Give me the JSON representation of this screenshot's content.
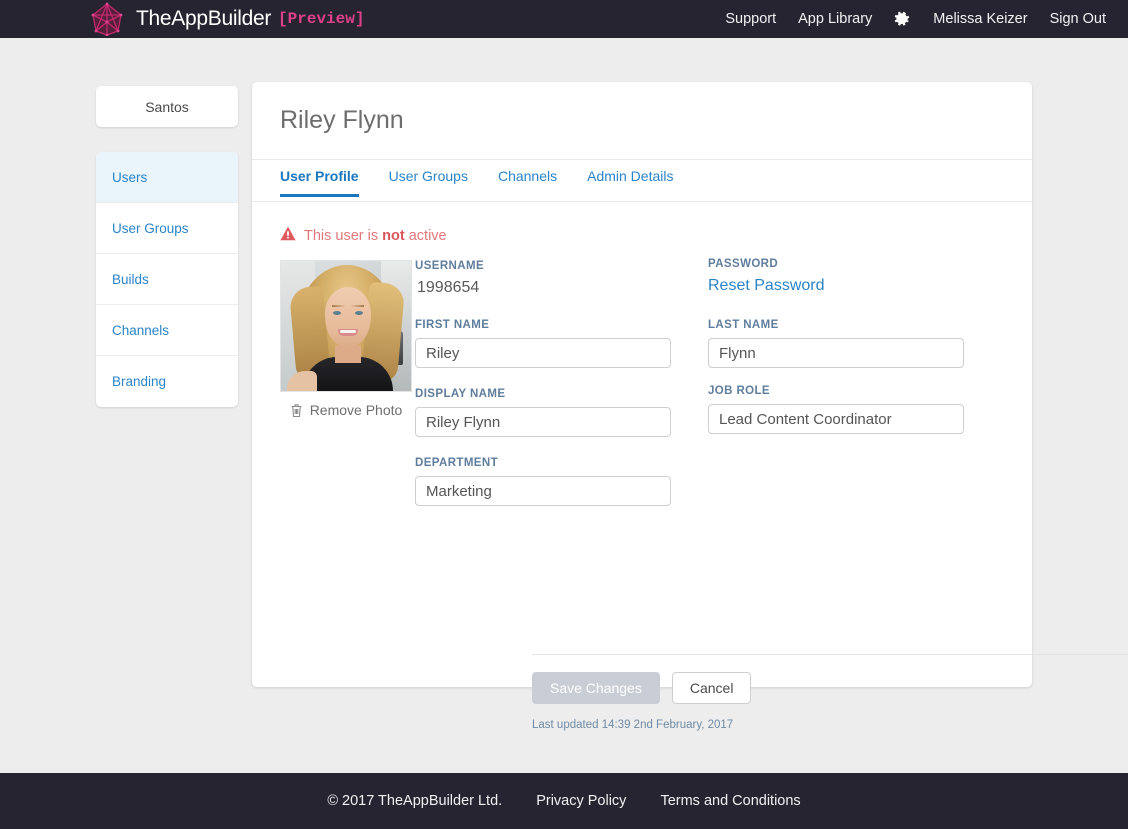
{
  "header": {
    "brand_name": "TheAppBuilder",
    "brand_tag": "[Preview]",
    "logo_icon": "crystal-polygon-logo",
    "nav": [
      {
        "label": "Support"
      },
      {
        "label": "App Library"
      }
    ],
    "settings_icon": "gear-icon",
    "user_name": "Melissa Keizer",
    "sign_out": "Sign Out",
    "background_color": "#262430",
    "accent_color": "#e0408a"
  },
  "sidebar": {
    "org_button": "Santos",
    "items": [
      {
        "label": "Users",
        "active": true
      },
      {
        "label": "User Groups",
        "active": false
      },
      {
        "label": "Builds",
        "active": false
      },
      {
        "label": "Channels",
        "active": false
      },
      {
        "label": "Branding",
        "active": false
      }
    ],
    "active_background": "#eaf4fb",
    "link_color": "#2a84c8"
  },
  "card": {
    "title": "Riley Flynn",
    "tabs": [
      {
        "label": "User Profile",
        "active": true
      },
      {
        "label": "User Groups",
        "active": false
      },
      {
        "label": "Channels",
        "active": false
      },
      {
        "label": "Admin Details",
        "active": false
      }
    ],
    "alert": {
      "icon": "warning-triangle-icon",
      "text_before": "This user is ",
      "text_bold": "not",
      "text_after": " active",
      "color": "#e2787c"
    },
    "photo": {
      "alt_description": "portrait-photo-of-user",
      "remove_label": "Remove Photo",
      "remove_icon": "trash-icon"
    },
    "form": {
      "username_label": "USERNAME",
      "username_value": "1998654",
      "password_label": "PASSWORD",
      "reset_password_link": "Reset Password",
      "first_name_label": "FIRST NAME",
      "first_name_value": "Riley",
      "last_name_label": "LAST NAME",
      "last_name_value": "Flynn",
      "display_name_label": "DISPLAY NAME",
      "display_name_value": "Riley Flynn",
      "job_role_label": "JOB ROLE",
      "job_role_value": "Lead Content Coordinator",
      "department_label": "DEPARTMENT",
      "department_value": "Marketing"
    },
    "actions": {
      "save_label": "Save Changes",
      "save_disabled": true,
      "cancel_label": "Cancel"
    },
    "last_updated": "Last updated 14:39 2nd February, 2017"
  },
  "footer": {
    "copyright": "© 2017 TheAppBuilder Ltd.",
    "links": [
      {
        "label": "Privacy Policy"
      },
      {
        "label": "Terms and Conditions"
      }
    ]
  }
}
